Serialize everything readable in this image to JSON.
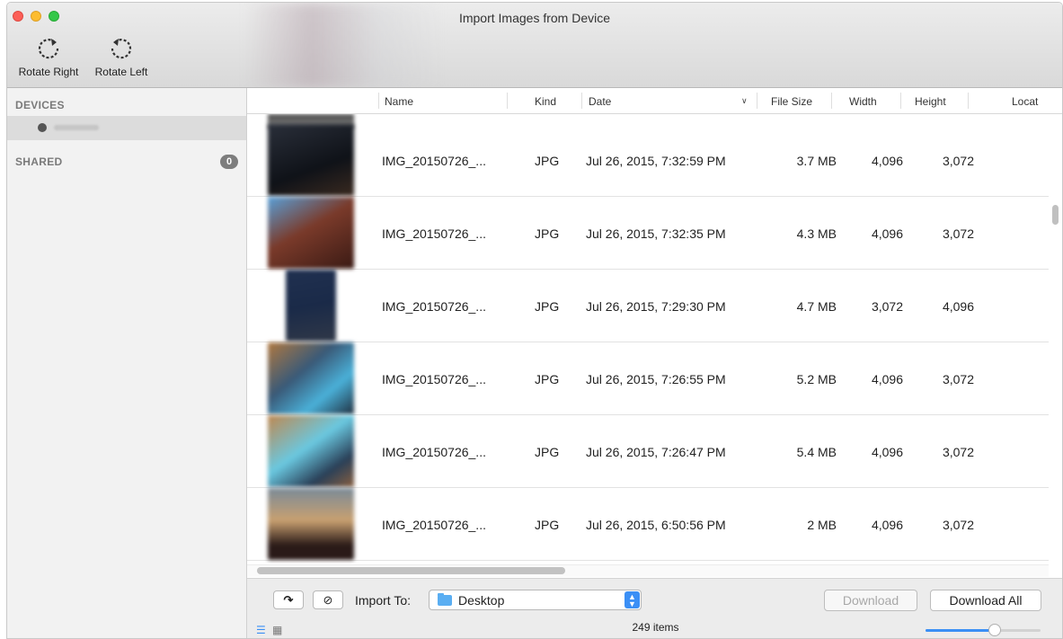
{
  "window": {
    "title": "Import Images from Device"
  },
  "toolbar": {
    "rotate_right": {
      "label": "Rotate Right",
      "icon": "rotate-right-icon"
    },
    "rotate_left": {
      "label": "Rotate Left",
      "icon": "rotate-left-icon"
    }
  },
  "sidebar": {
    "devices_header": "DEVICES",
    "shared_header": "SHARED",
    "shared_count": "0"
  },
  "table": {
    "columns": {
      "name": "Name",
      "kind": "Kind",
      "date": "Date",
      "file_size": "File Size",
      "width": "Width",
      "height": "Height",
      "location": "Locat"
    },
    "rows": [
      {
        "name": "IMG_20150726_...",
        "kind": "JPG",
        "date": "Jul 26, 2015, 7:32:59 PM",
        "size": "3.7 MB",
        "width": "4,096",
        "height": "3,072"
      },
      {
        "name": "IMG_20150726_...",
        "kind": "JPG",
        "date": "Jul 26, 2015, 7:32:35 PM",
        "size": "4.3 MB",
        "width": "4,096",
        "height": "3,072"
      },
      {
        "name": "IMG_20150726_...",
        "kind": "JPG",
        "date": "Jul 26, 2015, 7:29:30 PM",
        "size": "4.7 MB",
        "width": "3,072",
        "height": "4,096"
      },
      {
        "name": "IMG_20150726_...",
        "kind": "JPG",
        "date": "Jul 26, 2015, 7:26:55 PM",
        "size": "5.2 MB",
        "width": "4,096",
        "height": "3,072"
      },
      {
        "name": "IMG_20150726_...",
        "kind": "JPG",
        "date": "Jul 26, 2015, 7:26:47 PM",
        "size": "5.4 MB",
        "width": "4,096",
        "height": "3,072"
      },
      {
        "name": "IMG_20150726_...",
        "kind": "JPG",
        "date": "Jul 26, 2015, 6:50:56 PM",
        "size": "2 MB",
        "width": "4,096",
        "height": "3,072"
      }
    ]
  },
  "bottom": {
    "import_to_label": "Import To:",
    "destination": "Desktop",
    "download_label": "Download",
    "download_all_label": "Download All",
    "item_count": "249 items",
    "thumbnail_size_fraction": 0.6
  },
  "colors": {
    "accent": "#3b8ff5",
    "close": "#fc5f57",
    "minimize": "#fdbc2e",
    "maximize": "#33c748"
  }
}
